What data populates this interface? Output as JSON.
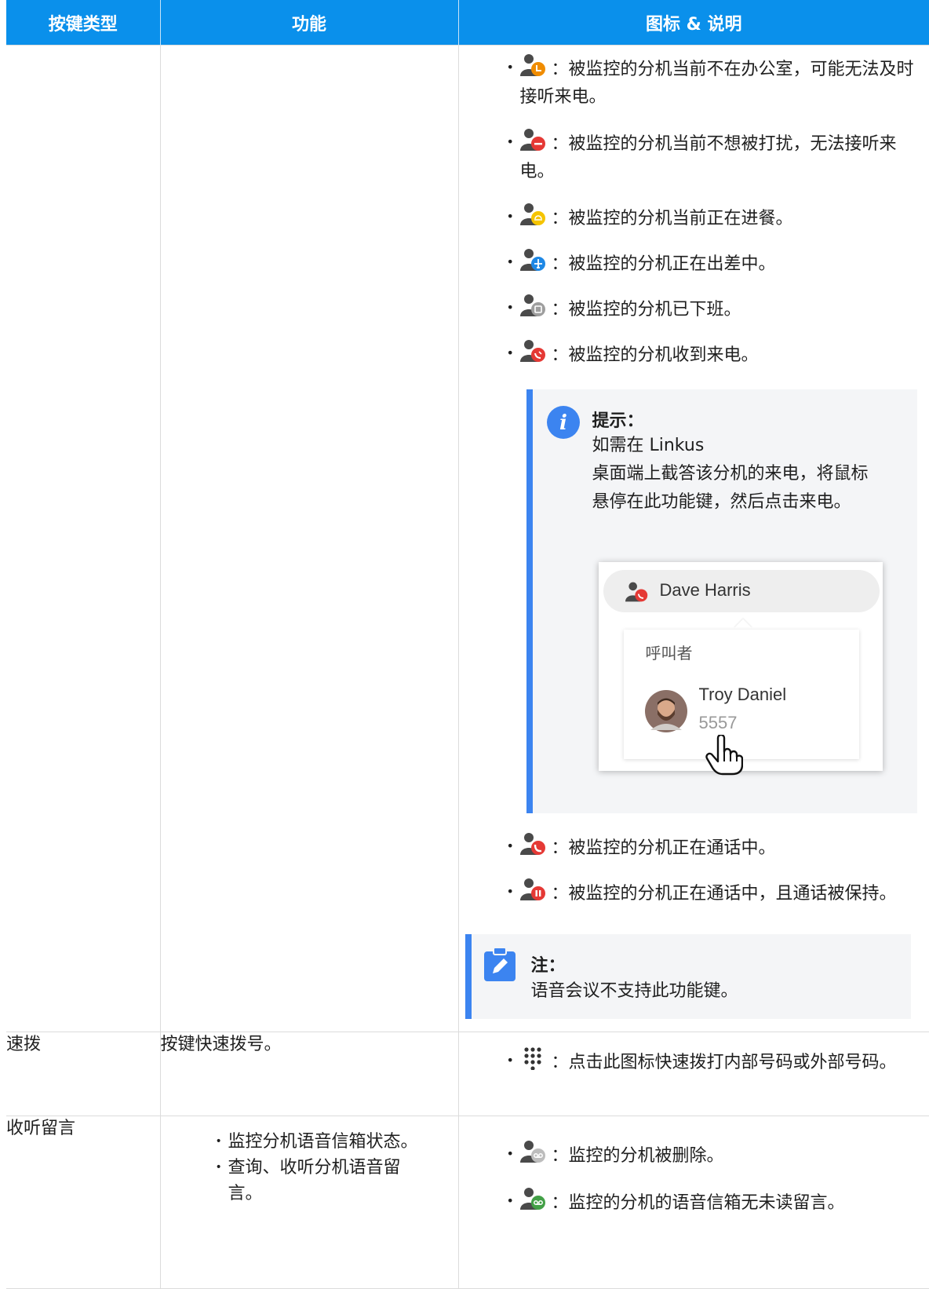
{
  "header": {
    "col1": "按键类型",
    "col2": "功能",
    "col3": "图标 & 说明"
  },
  "row1": {
    "items_top": [
      {
        "icon": "away-status-icon",
        "color": "#f08c00",
        "text": "：被监控的分机当前不在办公室，可能无法及时接听来电。"
      },
      {
        "icon": "do-not-disturb-icon",
        "color": "#e53935",
        "text": "：被监控的分机当前不想被打扰，无法接听来电。"
      },
      {
        "icon": "lunch-icon",
        "color": "#f5c400",
        "text": "：被监控的分机当前正在进餐。"
      },
      {
        "icon": "business-trip-icon",
        "color": "#1e88e5",
        "text": "：被监控的分机正在出差中。"
      },
      {
        "icon": "off-work-icon",
        "color": "#9e9e9e",
        "text": "：被监控的分机已下班。"
      },
      {
        "icon": "ringing-icon",
        "color": "#e53935",
        "text": "：被监控的分机收到来电。"
      }
    ],
    "tip": {
      "title": "提示：",
      "line1": "如需在 Linkus",
      "line2": "桌面端上截答该分机的来电，将鼠标悬停在此功能键，然后点击来电。",
      "popup": {
        "name": "Dave Harris",
        "label": "呼叫者",
        "caller_name": "Troy Daniel",
        "caller_number": "5557"
      }
    },
    "items_bottom": [
      {
        "icon": "in-call-icon",
        "color": "#e53935",
        "text": "：被监控的分机正在通话中。"
      },
      {
        "icon": "on-hold-icon",
        "color": "#e53935",
        "text": "：被监控的分机正在通话中，且通话被保持。"
      }
    ],
    "note": {
      "title": "注：",
      "body": "语音会议不支持此功能键。"
    }
  },
  "row2": {
    "type": "速拨",
    "function": "按键快速拨号。",
    "item": {
      "icon": "dialpad-icon",
      "text": "：点击此图标快速拨打内部号码或外部号码。"
    }
  },
  "row3": {
    "type": "收听留言",
    "function_lines": [
      "监控分机语音信箱状态。",
      "查询、收听分机语音留",
      "言。"
    ],
    "items": [
      {
        "icon": "voicemail-deleted-icon",
        "color": "#bdbdbd",
        "text": "：监控的分机被删除。"
      },
      {
        "icon": "voicemail-no-unread-icon",
        "color": "#43a047",
        "text": "：监控的分机的语音信箱无未读留言。"
      }
    ]
  }
}
